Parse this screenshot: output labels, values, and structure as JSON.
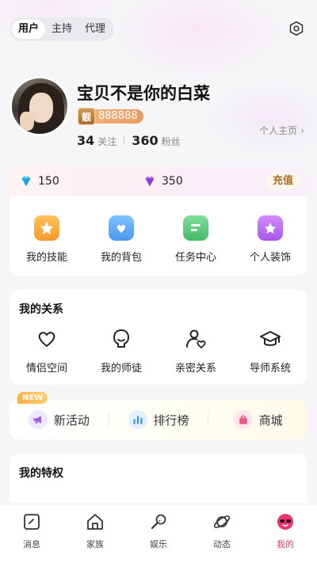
{
  "role_tabs": [
    "用户",
    "主持",
    "代理"
  ],
  "profile": {
    "nickname": "宝贝不是你的白菜",
    "level_crest": "靓",
    "level_number": "888888",
    "following_count": "34",
    "following_label": "关注",
    "fans_count": "360",
    "fans_label": "粉丝",
    "home_link": "个人主页"
  },
  "wallet": {
    "diamond_blue": "150",
    "diamond_purple": "350",
    "recharge_label": "充值"
  },
  "quick_grid": [
    {
      "label": "我的技能",
      "icon": "skill-icon",
      "color": "#f7a83a"
    },
    {
      "label": "我的背包",
      "icon": "backpack-icon",
      "color": "#5aa9f5"
    },
    {
      "label": "任务中心",
      "icon": "task-icon",
      "color": "#5cc97a"
    },
    {
      "label": "个人装饰",
      "icon": "decor-icon",
      "color": "#b46bf0"
    }
  ],
  "relations": {
    "title": "我的关系",
    "items": [
      "情侣空间",
      "我的师徒",
      "亲密关系",
      "导师系统"
    ]
  },
  "activity": {
    "badge": "NEW",
    "items": [
      "新活动",
      "排行榜",
      "商城"
    ]
  },
  "privilege": {
    "title": "我的特权"
  },
  "bottom_nav": [
    {
      "label": "消息"
    },
    {
      "label": "家族"
    },
    {
      "label": "娱乐"
    },
    {
      "label": "动态"
    },
    {
      "label": "我的",
      "active": true
    }
  ],
  "colors": {
    "accent": "#e8356f",
    "gold": "#a86a2a"
  }
}
